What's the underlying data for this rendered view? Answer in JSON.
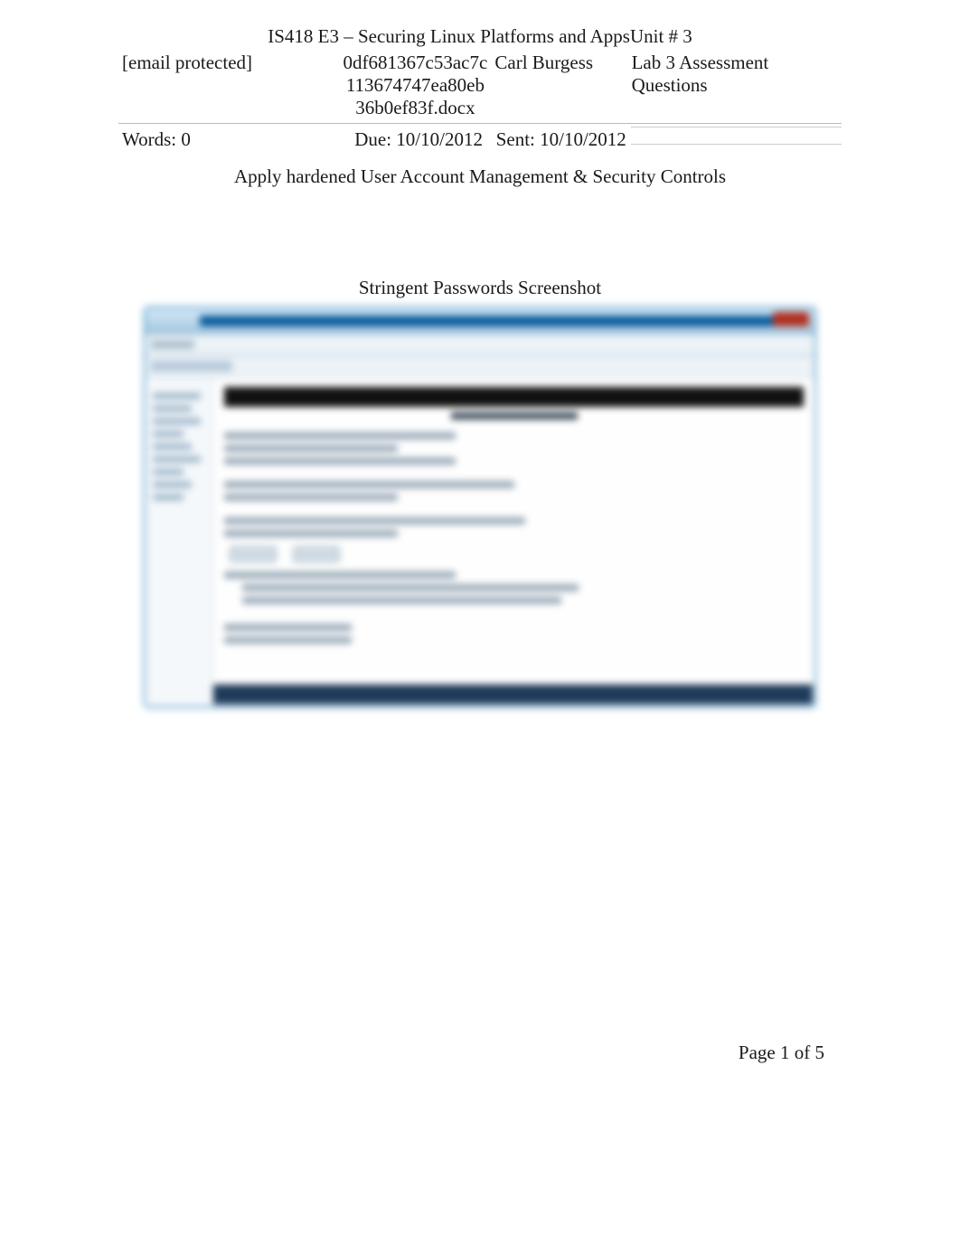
{
  "header": {
    "course_line": "IS418 E3 – Securing Linux Platforms and AppsUnit # 3",
    "email": "[email protected]",
    "filename_l1": "0df681367c53ac7c",
    "filename_l2": "113674747ea80eb",
    "filename_l3": "36b0ef83f.docx",
    "student": "Carl Burgess",
    "assignment": "Lab 3 Assessment Questions",
    "words_label": "Words: 0",
    "due_label": "Due: 10/10/2012",
    "sent_label": "Sent: 10/10/2012"
  },
  "body": {
    "section_title": "Apply hardened User Account Management & Security Controls",
    "screenshot_caption": "Stringent Passwords Screenshot"
  },
  "footer": {
    "page_label": "Page 1 of 5"
  }
}
